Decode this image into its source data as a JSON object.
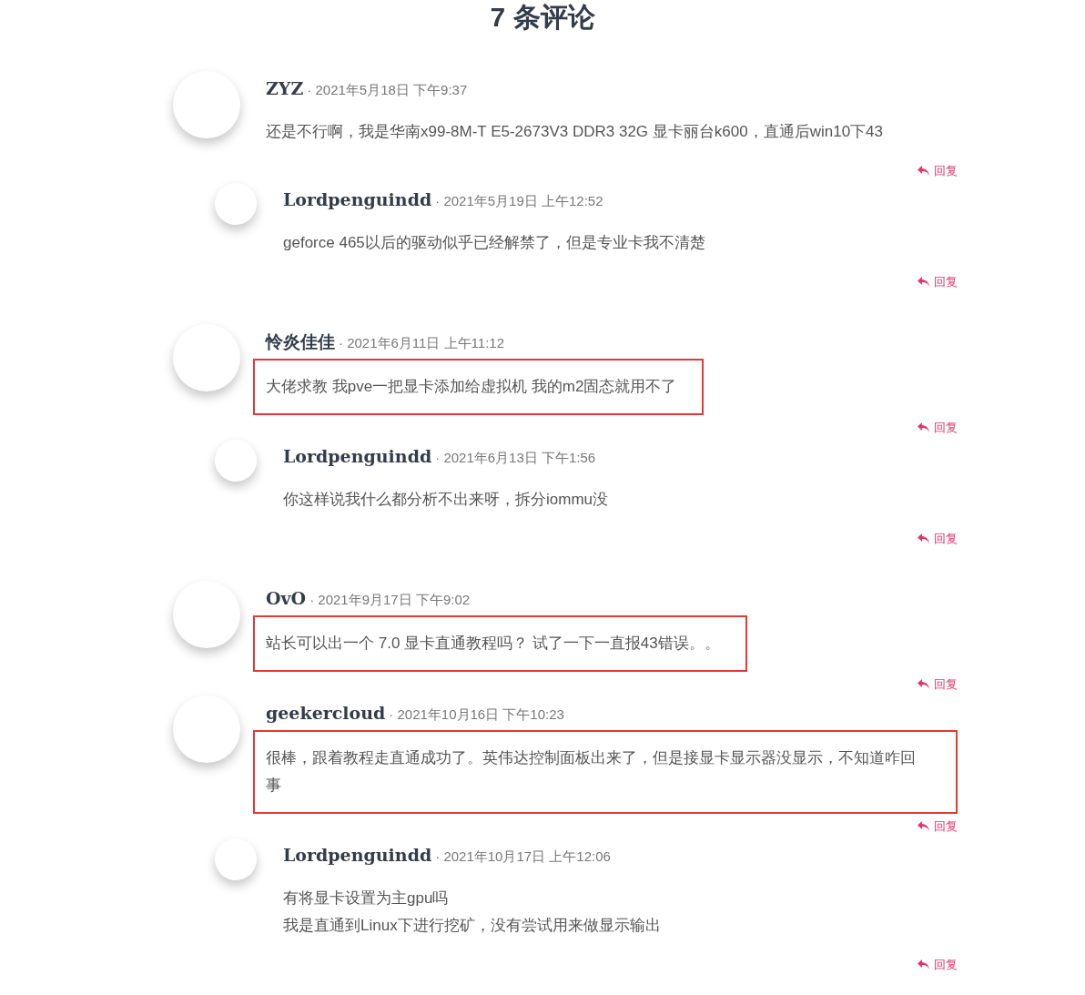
{
  "heading": "7 条评论",
  "comments": [
    {
      "author": "ZYZ",
      "date": "· 2021年5月18日 下午9:37",
      "body": [
        "还是不行啊，我是华南x99-8M-T E5-2673V3 DDR3 32G 显卡丽台k600，直通后win10下43"
      ],
      "highlighted": false,
      "reply_label": "回复",
      "children": [
        {
          "author": "Lordpenguindd",
          "date": "· 2021年5月19日 上午12:52",
          "body": [
            "geforce 465以后的驱动似乎已经解禁了，但是专业卡我不清楚"
          ],
          "highlighted": false,
          "reply_label": "回复"
        }
      ]
    },
    {
      "author": "怜炎佳佳",
      "date": "· 2021年6月11日 上午11:12",
      "body": [
        "大佬求教 我pve一把显卡添加给虚拟机 我的m2固态就用不了"
      ],
      "highlighted": true,
      "reply_label": "回复",
      "children": [
        {
          "author": "Lordpenguindd",
          "date": "· 2021年6月13日 下午1:56",
          "body": [
            "你这样说我什么都分析不出来呀，拆分iommu没"
          ],
          "highlighted": false,
          "reply_label": "回复"
        }
      ]
    },
    {
      "author": "OvO",
      "date": "· 2021年9月17日 下午9:02",
      "body": [
        "站长可以出一个 7.0 显卡直通教程吗？ 试了一下一直报43错误。。"
      ],
      "highlighted": true,
      "reply_label": "回复"
    },
    {
      "author": "geekercloud",
      "date": "· 2021年10月16日 下午10:23",
      "body": [
        "很棒，跟着教程走直通成功了。英伟达控制面板出来了，但是接显卡显示器没显示，不知道咋回事"
      ],
      "highlighted": true,
      "reply_label": "回复",
      "children": [
        {
          "author": "Lordpenguindd",
          "date": "· 2021年10月17日 上午12:06",
          "body": [
            "有将显卡设置为主gpu吗",
            "我是直通到Linux下进行挖矿，没有尝试用来做显示输出"
          ],
          "highlighted": false,
          "reply_label": "回复"
        }
      ]
    }
  ]
}
